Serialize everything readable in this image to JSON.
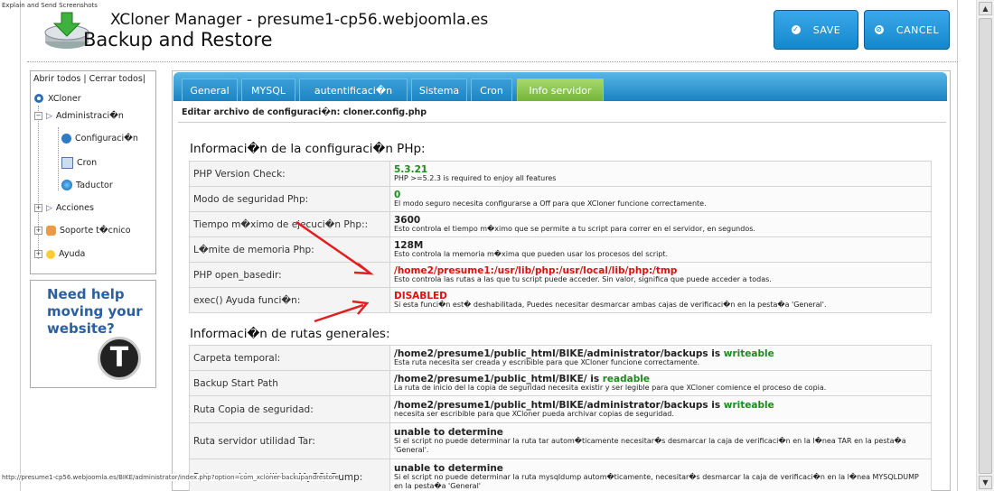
{
  "window": {
    "top_note": "Explain and Send Screenshots"
  },
  "header": {
    "title_line1": "XCloner Manager - presume1-cp56.webjoomla.es",
    "title_line2": "Backup and Restore",
    "save_label": "SAVE",
    "cancel_label": "CANCEL"
  },
  "sidebar": {
    "top_links": "Abrir todos | Cerrar todos|",
    "items": [
      {
        "label": "XCloner",
        "icon": "joomla-icon"
      },
      {
        "label": "Administraci�n",
        "icon": "triangle-icon"
      },
      {
        "label": "Configuraci�n",
        "icon": "gear-icon"
      },
      {
        "label": "Cron",
        "icon": "calendar-icon"
      },
      {
        "label": "Taductor",
        "icon": "globe-icon"
      },
      {
        "label": "Acciones",
        "icon": "triangle-icon"
      },
      {
        "label": "Soporte t�cnico",
        "icon": "support-icon"
      },
      {
        "label": "Ayuda",
        "icon": "lightbulb-icon"
      }
    ]
  },
  "ad": {
    "text": "Need help moving your website?",
    "logo_letter": "T"
  },
  "tabs": [
    {
      "label": "General"
    },
    {
      "label": "MYSQL"
    },
    {
      "label": "autentificaci�n"
    },
    {
      "label": "Sistema"
    },
    {
      "label": "Cron"
    },
    {
      "label": "Info servidor",
      "active": true
    }
  ],
  "edit_line": "Editar archivo de configuraci�n: cloner.config.php",
  "php_section": {
    "title": "Informaci�n de la configuraci�n PHp:",
    "rows": [
      {
        "label": "PHP Version Check:",
        "value": "5.3.21",
        "desc": "PHP >=5.2.3 is required to enjoy all features"
      },
      {
        "label": "Modo de seguridad Php:",
        "value": "0",
        "desc": "El modo seguro necesita configurarse a Off para que XCloner funcione correctamente."
      },
      {
        "label": "Tiempo m�ximo de ejecuci�n Php::",
        "value": "3600",
        "desc": "Esto controla el tiempo m�ximo que se permite a tu script para correr en el servidor, en segundos."
      },
      {
        "label": "L�mite de memoria Php:",
        "value": "128M",
        "desc": "Esto controla la memoria m�xima que pueden usar los procesos del script."
      },
      {
        "label": "PHP open_basedir:",
        "value": "/home2/presume1:/usr/lib/php:/usr/local/lib/php:/tmp",
        "desc": "Esto controla las rutas a las que tu script puede acceder. Sin valor, significa que puede acceder a todas."
      },
      {
        "label": "exec() Ayuda funci�n:",
        "value": "DISABLED",
        "desc": "Si esta funci�n est� deshabilitada, Puedes necesitar desmarcar ambas cajas de verificaci�n en la pesta�a 'General'."
      }
    ]
  },
  "paths_section": {
    "title": "Informaci�n de rutas generales:",
    "rows": [
      {
        "label": "Carpeta temporal:",
        "value": "/home2/presume1/public_html/BIKE/administrator/backups is ",
        "status": "writeable",
        "desc": "Esta ruta necesita ser creada y escribible para que XCloner funcione correctamente."
      },
      {
        "label": "Backup Start Path",
        "value": "/home2/presume1/public_html/BIKE/ is ",
        "status": "readable",
        "desc": "La ruta de inicio del la copia de seguridad necesita existir y ser legible para que XCloner comience el proceso de copia."
      },
      {
        "label": "Ruta Copia de seguridad:",
        "value": "/home2/presume1/public_html/BIKE/administrator/backups is ",
        "status": "writeable",
        "desc": "necesita ser escribible para que XCloner pueda archivar copias de seguridad."
      },
      {
        "label": "Ruta servidor utilidad Tar:",
        "value": "unable to determine",
        "desc": "Si el script no puede determinar la ruta tar autom�ticamente necesitar�s desmarcar la caja de verificaci�n en la l�nea TAR en la pesta�a 'General'."
      },
      {
        "label": "Ruta servidor utilidad MySQLDump:",
        "value": "unable to determine",
        "desc": "Si el script no puede determinar la ruta mysqldump autom�ticamente, necesitar�s desmarcar la caja de verificaci�n en la l�nea MYSQLDUMP en la pesta�a 'General'"
      }
    ]
  },
  "status_url": "http://presume1-cp56.webjoomla.es/BIKE/administrator/index.php?option=com_xcloner-backupandrestore",
  "colors": {
    "accent": "#1b82c2",
    "active_tab": "#74b53a",
    "ok": "#1d8a1d",
    "error": "#e01010",
    "arrow": "#e02020"
  }
}
